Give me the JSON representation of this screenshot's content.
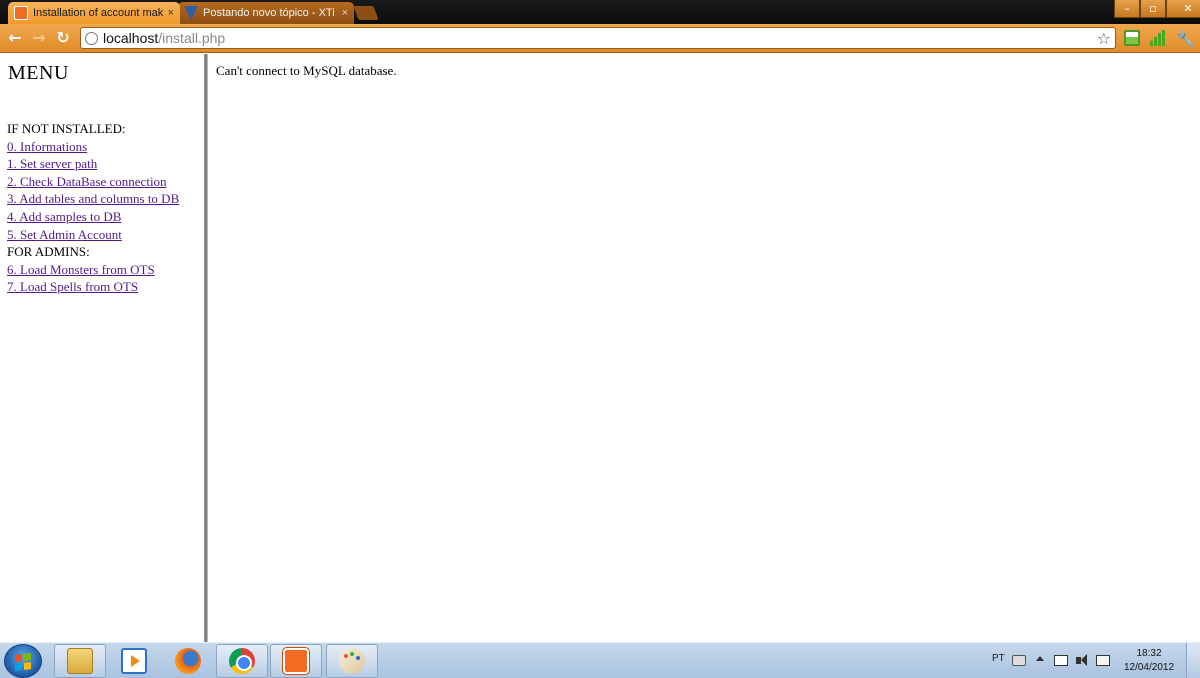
{
  "browser": {
    "tabs": [
      {
        "title": "Installation of account mak",
        "active": true,
        "favicon": "xampp-icon"
      },
      {
        "title": "Postando novo tópico - XTi",
        "active": false,
        "favicon": "xtibia-icon"
      }
    ],
    "close_glyph": "×",
    "url": {
      "host": "localhost",
      "path": "/install.php"
    },
    "window_controls": {
      "minimize": "–",
      "maximize": "▫",
      "close": "✕"
    },
    "nav": {
      "back": "←",
      "forward": "→",
      "reload": "↻"
    }
  },
  "menu": {
    "title": "MENU",
    "section_not_installed": "IF NOT INSTALLED:",
    "install_links": [
      "0. Informations",
      "1. Set server path",
      "2. Check DataBase connection",
      "3. Add tables and columns to DB",
      "4. Add samples to DB",
      "5. Set Admin Account"
    ],
    "section_admins": "FOR ADMINS:",
    "admin_links": [
      "6. Load Monsters from OTS",
      "7. Load Spells from OTS"
    ]
  },
  "content": {
    "message": "Can't connect to MySQL database."
  },
  "taskbar": {
    "pinned": [
      "explorer-icon",
      "media-player-icon",
      "firefox-icon",
      "chrome-icon",
      "xampp-icon",
      "paint-icon"
    ],
    "language": "PT",
    "time": "18:32",
    "date": "12/04/2012"
  },
  "colors": {
    "chrome_orange": "#ee9a2d",
    "visited_link": "#551a8b",
    "taskbar": "#a9c2df"
  }
}
